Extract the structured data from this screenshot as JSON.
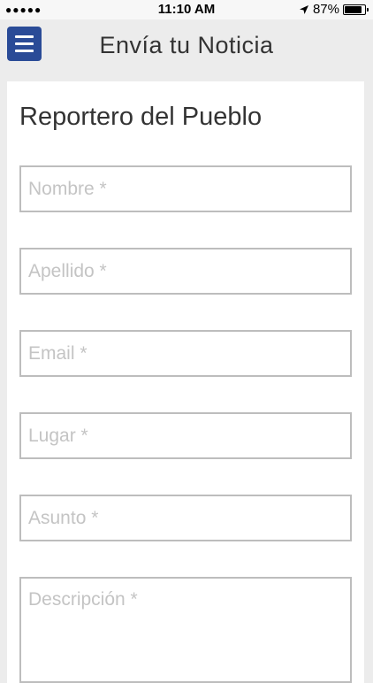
{
  "status_bar": {
    "signal": "●●●●●",
    "time": "11:10 AM",
    "battery": "87%",
    "battery_level": 0.87
  },
  "nav": {
    "title": "Envía tu Noticia"
  },
  "form": {
    "title": "Reportero del Pueblo",
    "fields": [
      {
        "placeholder": "Nombre *",
        "value": ""
      },
      {
        "placeholder": "Apellido *",
        "value": ""
      },
      {
        "placeholder": "Email *",
        "value": ""
      },
      {
        "placeholder": "Lugar *",
        "value": ""
      },
      {
        "placeholder": "Asunto *",
        "value": ""
      },
      {
        "placeholder": "Descripción *",
        "value": ""
      }
    ]
  },
  "colors": {
    "menu_button": "#2a4b97",
    "field_border": "#bdbdbd",
    "background": "#ececec"
  }
}
